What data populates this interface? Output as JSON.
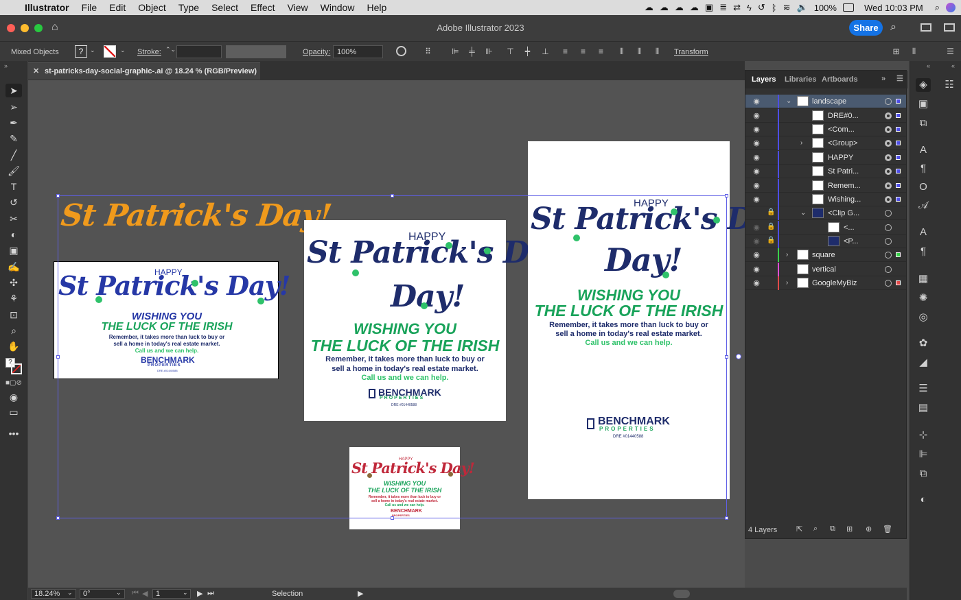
{
  "menubar": {
    "apple": "",
    "items": [
      "Illustrator",
      "File",
      "Edit",
      "Object",
      "Type",
      "Select",
      "Effect",
      "View",
      "Window",
      "Help"
    ],
    "battery": "100%",
    "clock": "Wed 10:03 PM"
  },
  "window": {
    "title": "Adobe Illustrator 2023",
    "share_label": "Share"
  },
  "control": {
    "selection_type": "Mixed Objects",
    "fill_value": "?",
    "stroke_label": "Stroke:",
    "opacity_label": "Opacity:",
    "opacity_value": "100%",
    "transform_label": "Transform"
  },
  "document": {
    "tab_title": "st-patricks-day-social-graphic-.ai @ 18.24 % (RGB/Preview)"
  },
  "artwork": {
    "script_title": "St Patrick's Day!",
    "happy": "HAPPY",
    "script_day": "Day!",
    "wishing": "WISHING YOU",
    "luck": "THE LUCK OF THE IRISH",
    "remember_1": "Remember, it takes more than luck to buy or",
    "remember_2": "sell a home in today's real estate market.",
    "call": "Call us and we can help.",
    "brand": "BENCHMARK",
    "brand_sub": "PROPERTIES",
    "dre": "DRE #01440588"
  },
  "status": {
    "zoom": "18.24%",
    "rotation": "0°",
    "artboard": "1",
    "tool": "Selection"
  },
  "layers_panel": {
    "tabs": [
      "Layers",
      "Libraries",
      "Artboards"
    ],
    "rows": [
      {
        "name": "landscape"
      },
      {
        "name": "DRE#0..."
      },
      {
        "name": "<Com..."
      },
      {
        "name": "<Group>"
      },
      {
        "name": "HAPPY"
      },
      {
        "name": "St  Patri..."
      },
      {
        "name": "Remem..."
      },
      {
        "name": "Wishing..."
      },
      {
        "name": "<Clip G..."
      },
      {
        "name": "<..."
      },
      {
        "name": "<P..."
      },
      {
        "name": "square"
      },
      {
        "name": "vertical"
      },
      {
        "name": "GoogleMyBiz"
      }
    ],
    "count": "4 Layers"
  },
  "colors": {
    "navy": "#1e2c6b",
    "green": "#19a35a",
    "light_green": "#2fc26a",
    "orange": "#f09a1c",
    "red": "#c0283a",
    "blue_script": "#2638a6",
    "accent": "#1473e6"
  }
}
